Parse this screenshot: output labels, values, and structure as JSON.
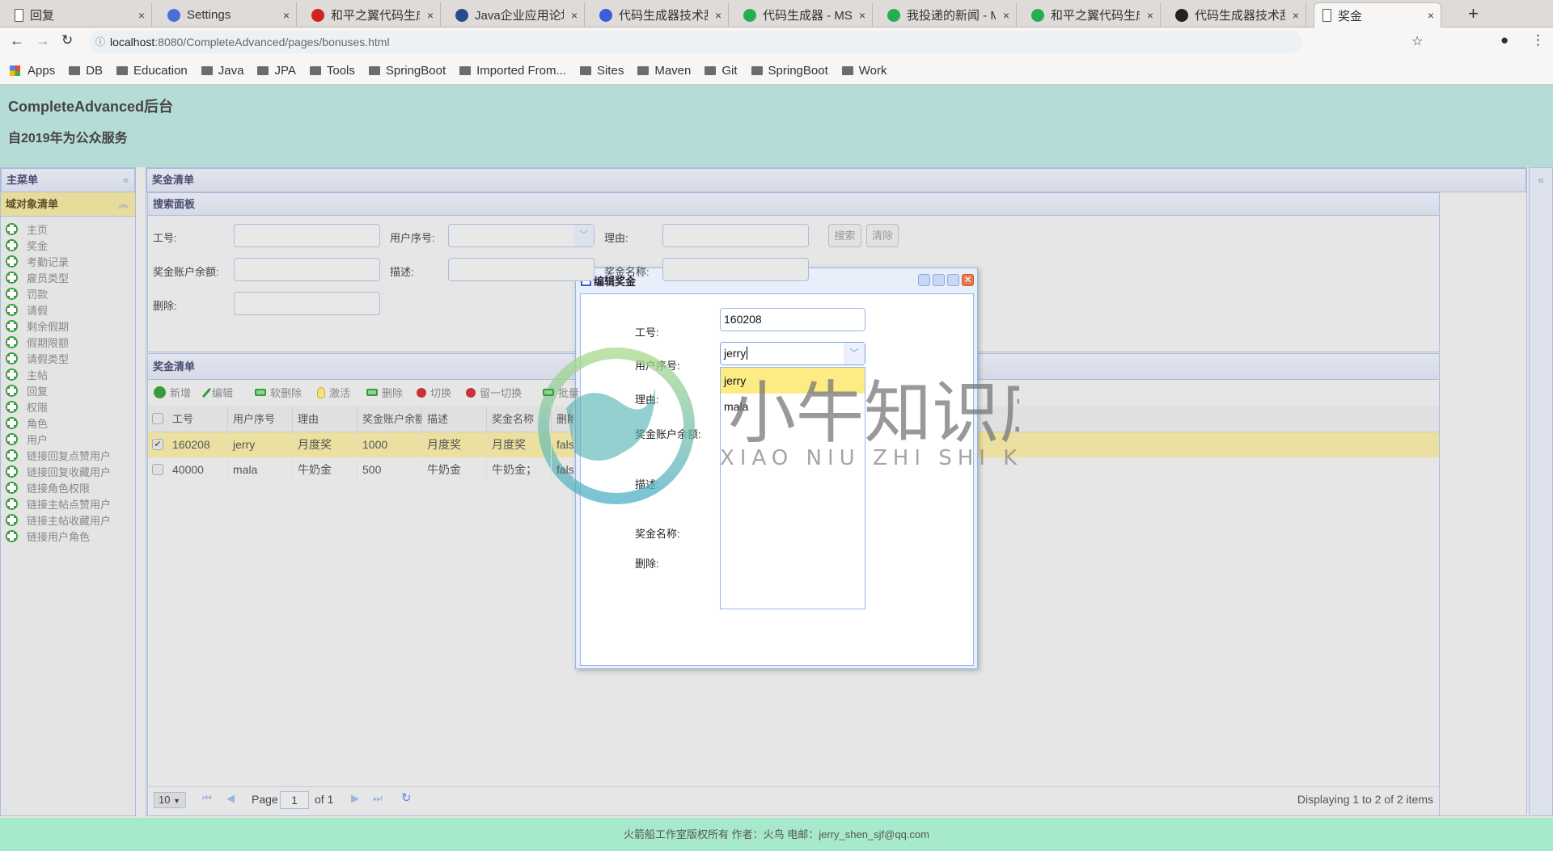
{
  "browser": {
    "tabs": [
      {
        "title": "回复",
        "icon": "page-icon"
      },
      {
        "title": "Settings",
        "icon": "gear-icon"
      },
      {
        "title": "和平之翼代码生成",
        "icon": "g-logo-icon"
      },
      {
        "title": "Java企业应用论坛",
        "icon": "forum-icon"
      },
      {
        "title": "代码生成器技术乱",
        "icon": "baidu-paw-icon"
      },
      {
        "title": "代码生成器 - MS",
        "icon": "c-logo-icon"
      },
      {
        "title": "我投递的新闻 - M",
        "icon": "c-logo-icon"
      },
      {
        "title": "和平之翼代码生成",
        "icon": "c-logo-icon"
      },
      {
        "title": "代码生成器技术乱",
        "icon": "money-bag-icon"
      },
      {
        "title": "奖金",
        "icon": "page-icon",
        "active": true
      }
    ],
    "url_host": "localhost",
    "url_rest": ":8080/CompleteAdvanced/pages/bonuses.html",
    "bookmarks": [
      "Apps",
      "DB",
      "Education",
      "Java",
      "JPA",
      "Tools",
      "SpringBoot",
      "Imported From...",
      "Sites",
      "Maven",
      "Git",
      "SpringBoot",
      "Work"
    ]
  },
  "header": {
    "title": "CompleteAdvanced后台",
    "subtitle": "自2019年为公众服务"
  },
  "sidebar": {
    "title": "主菜单",
    "section": "域对象清单",
    "items": [
      "主页",
      "奖金",
      "考勤记录",
      "雇员类型",
      "罚款",
      "请假",
      "剩余假期",
      "假期限额",
      "请假类型",
      "主帖",
      "回复",
      "权限",
      "角色",
      "用户",
      "链接回复点赞用户",
      "链接回复收藏用户",
      "链接角色权限",
      "链接主帖点赞用户",
      "链接主帖收藏用户",
      "链接用户角色"
    ]
  },
  "main": {
    "title": "奖金清单",
    "search": {
      "title": "搜索面板",
      "labels": [
        "工号:",
        "用户序号:",
        "理由:",
        "奖金账户余额:",
        "描述:",
        "奖金名称:",
        "删除:"
      ],
      "search_btn": "搜索",
      "clear_btn": "清除"
    },
    "grid": {
      "title": "奖金清单",
      "toolbar": [
        "新增",
        "编辑",
        "软删除",
        "激活",
        "删除",
        "切换",
        "留一切换",
        "批量"
      ],
      "columns": [
        "工号",
        "用户序号",
        "理由",
        "奖金账户余额",
        "描述",
        "奖金名称",
        "删除"
      ],
      "rows": [
        [
          "160208",
          "jerry",
          "月度奖",
          "1000",
          "月度奖",
          "月度奖",
          "false"
        ],
        [
          "40000",
          "mala",
          "牛奶金",
          "500",
          "牛奶金",
          "牛奶金；",
          "false"
        ]
      ],
      "selected_row": 0
    },
    "pager": {
      "page_size": "10",
      "page_label": "Page",
      "page": "1",
      "of": "of 1",
      "display": "Displaying 1 to 2 of 2 items"
    }
  },
  "dialog": {
    "title": "编辑奖金",
    "labels": [
      "工号:",
      "用户序号:",
      "理由:",
      "奖金账户余额:",
      "描述:",
      "奖金名称:",
      "删除:"
    ],
    "id_value": "160208",
    "user_value": "jerry",
    "options": [
      "jerry",
      "mala"
    ],
    "highlighted_option": "jerry"
  },
  "watermark": {
    "cn": "小牛知识库",
    "en": "XIAO NIU ZHI SHI KU"
  },
  "footer": "火箭船工作室版权所有 作者：火鸟 电邮：jerry_shen_sjf@qq.com",
  "colors": {
    "header_bg": "#b5dcd6",
    "footer_bg": "#a6eacb",
    "accordion": "#e8dc9d",
    "selected_row": "#ebe09f",
    "highlight_option": "#fdec83"
  }
}
